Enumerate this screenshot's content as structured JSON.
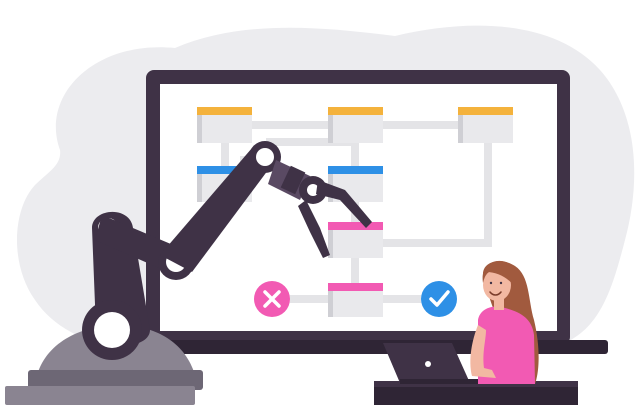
{
  "colors": {
    "background": "#ffffff",
    "blob": "#ececef",
    "monitor_frame": "#3f3246",
    "monitor_stand": "#2f2535",
    "screen": "#ffffff",
    "connector": "#e4e4e7",
    "card_body": "#e9e9ec",
    "card_shadow": "#cfcfd4",
    "tab_orange": "#f4b23c",
    "tab_blue": "#2e90e6",
    "tab_pink": "#f25ab3",
    "reject_circle": "#f25ab3",
    "approve_circle": "#2e90e6",
    "robot_dark": "#3f3246",
    "robot_mid": "#5a4a63",
    "robot_joint": "#ffffff",
    "robot_base_grey": "#8a8491",
    "person_skin": "#f2b8a2",
    "person_hair": "#a15a3e",
    "person_top": "#f25ab3",
    "laptop": "#3f3246",
    "desk": "#2f2535"
  },
  "icons": {
    "reject": "close-icon",
    "approve": "check-icon"
  },
  "workflow": {
    "cards": [
      {
        "name": "workflow-card-top-left",
        "tab": "orange"
      },
      {
        "name": "workflow-card-top-center",
        "tab": "orange"
      },
      {
        "name": "workflow-card-top-right",
        "tab": "orange"
      },
      {
        "name": "workflow-card-mid-left",
        "tab": "blue"
      },
      {
        "name": "workflow-card-mid-center",
        "tab": "blue"
      },
      {
        "name": "workflow-card-pink-upper",
        "tab": "pink"
      },
      {
        "name": "workflow-card-pink-lower",
        "tab": "pink"
      }
    ]
  }
}
